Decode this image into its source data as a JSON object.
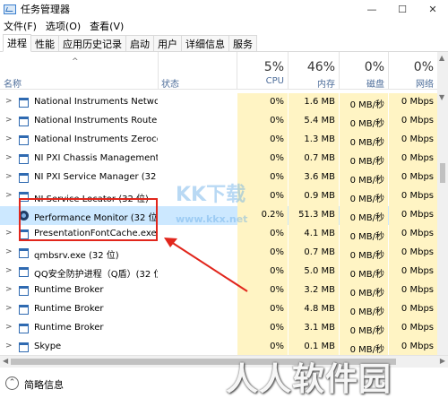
{
  "window": {
    "title": "任务管理器",
    "controls": [
      "—",
      "☐",
      "✕"
    ]
  },
  "menu": [
    "文件(F)",
    "选项(O)",
    "查看(V)"
  ],
  "tabs": [
    {
      "label": "进程",
      "active": true
    },
    {
      "label": "性能",
      "active": false
    },
    {
      "label": "应用历史记录",
      "active": false
    },
    {
      "label": "启动",
      "active": false
    },
    {
      "label": "用户",
      "active": false
    },
    {
      "label": "详细信息",
      "active": false
    },
    {
      "label": "服务",
      "active": false
    }
  ],
  "header": {
    "sort_arrow": "^",
    "name_label": "名称",
    "status_label": "状态",
    "cpu": {
      "pct": "5%",
      "label": "CPU"
    },
    "memory": {
      "pct": "46%",
      "label": "内存"
    },
    "disk": {
      "pct": "0%",
      "label": "磁盘"
    },
    "network": {
      "pct": "0%",
      "label": "网络"
    }
  },
  "processes": [
    {
      "name": "National Instruments Networ...",
      "cpu": "0%",
      "mem": "1.6 MB",
      "disk": "0 MB/秒",
      "net": "0 Mbps",
      "icon": "process-icon"
    },
    {
      "name": "National Instruments Route ...",
      "cpu": "0%",
      "mem": "5.4 MB",
      "disk": "0 MB/秒",
      "net": "0 Mbps",
      "icon": "process-icon"
    },
    {
      "name": "National Instruments Zeroco...",
      "cpu": "0%",
      "mem": "1.3 MB",
      "disk": "0 MB/秒",
      "net": "0 Mbps",
      "icon": "process-icon"
    },
    {
      "name": "NI PXI Chassis Management ...",
      "cpu": "0%",
      "mem": "0.7 MB",
      "disk": "0 MB/秒",
      "net": "0 Mbps",
      "icon": "process-icon"
    },
    {
      "name": "NI PXI Service Manager (32 ...",
      "cpu": "0%",
      "mem": "3.6 MB",
      "disk": "0 MB/秒",
      "net": "0 Mbps",
      "icon": "process-icon"
    },
    {
      "name": "NI Service Locator (32 位)",
      "cpu": "0%",
      "mem": "0.9 MB",
      "disk": "0 MB/秒",
      "net": "0 Mbps",
      "icon": "process-icon"
    },
    {
      "name": "Performance Monitor (32 位)",
      "cpu": "0.2%",
      "mem": "51.3 MB",
      "disk": "0 MB/秒",
      "net": "0 Mbps",
      "icon": "performance-monitor-icon"
    },
    {
      "name": "PresentationFontCache.exe",
      "cpu": "0%",
      "mem": "4.1 MB",
      "disk": "0 MB/秒",
      "net": "0 Mbps",
      "icon": "process-icon"
    },
    {
      "name": "qmbsrv.exe (32 位)",
      "cpu": "0%",
      "mem": "0.7 MB",
      "disk": "0 MB/秒",
      "net": "0 Mbps",
      "icon": "process-icon"
    },
    {
      "name": "QQ安全防护进程（Q盾）(32 位)",
      "cpu": "0%",
      "mem": "5.0 MB",
      "disk": "0 MB/秒",
      "net": "0 Mbps",
      "icon": "process-icon"
    },
    {
      "name": "Runtime Broker",
      "cpu": "0%",
      "mem": "3.2 MB",
      "disk": "0 MB/秒",
      "net": "0 Mbps",
      "icon": "process-icon"
    },
    {
      "name": "Runtime Broker",
      "cpu": "0%",
      "mem": "4.8 MB",
      "disk": "0 MB/秒",
      "net": "0 Mbps",
      "icon": "process-icon"
    },
    {
      "name": "Runtime Broker",
      "cpu": "0%",
      "mem": "3.1 MB",
      "disk": "0 MB/秒",
      "net": "0 Mbps",
      "icon": "process-icon"
    },
    {
      "name": "Skype",
      "cpu": "0%",
      "mem": "0.1 MB",
      "disk": "0 MB/秒",
      "net": "0 Mbps",
      "icon": "process-icon"
    }
  ],
  "highlighted_row": "Performance Monitor (32 位)",
  "status": {
    "brief_label": "简略信息"
  },
  "watermarks": {
    "kk": "KK下载",
    "url": "www.kkx.net",
    "brand": "人人软件园"
  },
  "colors": {
    "highlight": "#cce8ff",
    "resource_cell": "#fff4c4",
    "annotation": "#e1261c"
  }
}
